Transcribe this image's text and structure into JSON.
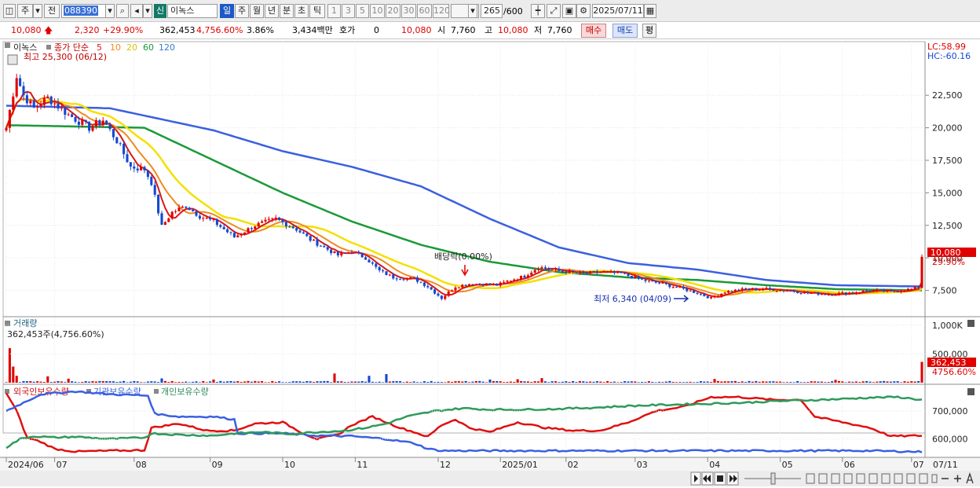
{
  "toolbar": {
    "market": "주",
    "prefix": "전",
    "code": "088390",
    "badge": "신",
    "stock_name": "이녹스",
    "periods": [
      "일",
      "주",
      "월",
      "년",
      "분",
      "초",
      "틱"
    ],
    "minutes": [
      "1",
      "3",
      "5",
      "10",
      "20",
      "30",
      "60",
      "120"
    ],
    "count": "265",
    "count_total": "/600",
    "date": "2025/07/11"
  },
  "quote": {
    "price": "10,080",
    "change": "2,320",
    "change_pct": "+29.90%",
    "volume": "362,453",
    "volume_pct": "4,756.60%",
    "turnover_pct": "3.86%",
    "amount": "3,434백만",
    "hoga_label": "호가",
    "hoga_value": "0",
    "hoga_price": "10,080",
    "open_label": "시",
    "open": "7,760",
    "high_label": "고",
    "high": "10,080",
    "low_label": "저",
    "low": "7,760",
    "buy": "매수",
    "sell": "매도",
    "avg": "평"
  },
  "colors": {
    "up": "#e00000",
    "down": "#1448d0",
    "ma5": "#d81818",
    "ma10": "#f08a20",
    "ma20": "#f4e000",
    "ma60": "#1a9a38",
    "ma120": "#3a60e0",
    "foreign": "#e01010",
    "institution": "#3a60e0",
    "individual": "#2e9a5a"
  },
  "chart_data": [
    {
      "type": "candlestick",
      "legend": {
        "name": "이녹스",
        "close_label": "종가 단순",
        "ma": [
          "5",
          "10",
          "20",
          "60",
          "120"
        ]
      },
      "high_note": "최고 25,300 (06/12)",
      "low_note": "최저 6,340 (04/09)",
      "event_note": "배당락(0.00%)",
      "lc": "LC:58.99",
      "hc": "HC:-60.16",
      "last_price_label": "10,080",
      "last_pct_label": "29.90%",
      "ylim": [
        5600,
        26500
      ],
      "yticks": [
        "22,500",
        "20,000",
        "17,500",
        "15,000",
        "12,500",
        "10,000",
        "7,500"
      ],
      "ytick_values": [
        22500,
        20000,
        17500,
        15000,
        12500,
        10000,
        7500
      ],
      "xticks": [
        "2024/06",
        "07",
        "08",
        "09",
        "10",
        "11",
        "12",
        "2025/01",
        "02",
        "03",
        "04",
        "05",
        "06",
        "07",
        "07/11"
      ],
      "xtick_days": [
        0,
        14,
        37,
        59,
        80,
        101,
        125,
        143,
        162,
        182,
        203,
        224,
        242,
        262,
        265
      ],
      "close_anchors": [
        [
          0,
          20000
        ],
        [
          3,
          24000
        ],
        [
          5,
          22500
        ],
        [
          8,
          21500
        ],
        [
          12,
          22300
        ],
        [
          18,
          21000
        ],
        [
          24,
          20000
        ],
        [
          28,
          20600
        ],
        [
          32,
          19000
        ],
        [
          36,
          17000
        ],
        [
          40,
          16800
        ],
        [
          42,
          15800
        ],
        [
          45,
          12400
        ],
        [
          48,
          13500
        ],
        [
          52,
          14000
        ],
        [
          56,
          13200
        ],
        [
          60,
          12800
        ],
        [
          66,
          11600
        ],
        [
          72,
          12500
        ],
        [
          78,
          13000
        ],
        [
          84,
          12200
        ],
        [
          88,
          11400
        ],
        [
          92,
          10800
        ],
        [
          96,
          10200
        ],
        [
          100,
          10500
        ],
        [
          104,
          10000
        ],
        [
          108,
          9000
        ],
        [
          112,
          8500
        ],
        [
          118,
          8400
        ],
        [
          122,
          7800
        ],
        [
          126,
          6900
        ],
        [
          130,
          7800
        ],
        [
          134,
          8000
        ],
        [
          138,
          8000
        ],
        [
          142,
          7900
        ],
        [
          146,
          8300
        ],
        [
          150,
          8600
        ],
        [
          154,
          9300
        ],
        [
          160,
          9000
        ],
        [
          166,
          8800
        ],
        [
          172,
          8900
        ],
        [
          178,
          8800
        ],
        [
          184,
          8300
        ],
        [
          190,
          8000
        ],
        [
          196,
          7600
        ],
        [
          200,
          7300
        ],
        [
          204,
          6900
        ],
        [
          208,
          7400
        ],
        [
          214,
          7600
        ],
        [
          220,
          7600
        ],
        [
          226,
          7500
        ],
        [
          232,
          7300
        ],
        [
          238,
          7200
        ],
        [
          244,
          7300
        ],
        [
          250,
          7500
        ],
        [
          256,
          7400
        ],
        [
          262,
          7600
        ],
        [
          264,
          7760
        ],
        [
          265,
          10080
        ]
      ],
      "ma60_anchors": [
        [
          0,
          20200
        ],
        [
          40,
          20000
        ],
        [
          60,
          17500
        ],
        [
          80,
          15000
        ],
        [
          100,
          12800
        ],
        [
          120,
          11000
        ],
        [
          140,
          9700
        ],
        [
          160,
          8900
        ],
        [
          180,
          8500
        ],
        [
          200,
          8300
        ],
        [
          220,
          7900
        ],
        [
          240,
          7600
        ],
        [
          265,
          7500
        ]
      ],
      "ma120_anchors": [
        [
          0,
          21700
        ],
        [
          30,
          21500
        ],
        [
          60,
          19800
        ],
        [
          80,
          18200
        ],
        [
          100,
          17000
        ],
        [
          120,
          15500
        ],
        [
          140,
          13000
        ],
        [
          160,
          10800
        ],
        [
          180,
          9600
        ],
        [
          200,
          9100
        ],
        [
          220,
          8300
        ],
        [
          240,
          7900
        ],
        [
          265,
          7800
        ]
      ]
    },
    {
      "type": "bar",
      "title": "거래량",
      "label": "362,453주(4,756.60%)",
      "ylim": [
        0,
        1120000
      ],
      "yticks": [
        "1,000K",
        "500,000"
      ],
      "ytick_values": [
        1000000,
        500000
      ],
      "last_label": "362,453",
      "last_pct": "4756.60%",
      "spikes": [
        [
          1,
          600000
        ],
        [
          2,
          280000
        ],
        [
          3,
          120000
        ],
        [
          12,
          110000
        ],
        [
          18,
          70000
        ],
        [
          45,
          75000
        ],
        [
          60,
          55000
        ],
        [
          95,
          160000
        ],
        [
          105,
          120000
        ],
        [
          110,
          150000
        ],
        [
          140,
          55000
        ],
        [
          148,
          60000
        ],
        [
          155,
          80000
        ],
        [
          205,
          65000
        ],
        [
          240,
          50000
        ],
        [
          265,
          362453
        ]
      ]
    },
    {
      "type": "line",
      "series": [
        {
          "name": "외국인보유수량",
          "anchors": [
            [
              0,
              765000
            ],
            [
              3,
              700000
            ],
            [
              6,
              605000
            ],
            [
              10,
              590000
            ],
            [
              14,
              565000
            ],
            [
              20,
              555000
            ],
            [
              30,
              558000
            ],
            [
              40,
              560000
            ],
            [
              42,
              640000
            ],
            [
              50,
              655000
            ],
            [
              58,
              630000
            ],
            [
              66,
              630000
            ],
            [
              72,
              655000
            ],
            [
              80,
              660000
            ],
            [
              86,
              620000
            ],
            [
              90,
              600000
            ],
            [
              96,
              615000
            ],
            [
              100,
              650000
            ],
            [
              106,
              680000
            ],
            [
              110,
              660000
            ],
            [
              114,
              640000
            ],
            [
              118,
              625000
            ],
            [
              122,
              608000
            ],
            [
              126,
              650000
            ],
            [
              130,
              670000
            ],
            [
              134,
              640000
            ],
            [
              140,
              625000
            ],
            [
              148,
              660000
            ],
            [
              156,
              640000
            ],
            [
              164,
              630000
            ],
            [
              172,
              630000
            ],
            [
              180,
              660000
            ],
            [
              188,
              700000
            ],
            [
              196,
              715000
            ],
            [
              204,
              750000
            ],
            [
              212,
              750000
            ],
            [
              222,
              740000
            ],
            [
              230,
              740000
            ],
            [
              234,
              680000
            ],
            [
              242,
              660000
            ],
            [
              250,
              640000
            ],
            [
              256,
              610000
            ],
            [
              265,
              612000
            ]
          ]
        },
        {
          "name": "기관보유수량",
          "anchors": [
            [
              0,
              700000
            ],
            [
              10,
              760000
            ],
            [
              20,
              770000
            ],
            [
              30,
              760000
            ],
            [
              41,
              755000
            ],
            [
              43,
              690000
            ],
            [
              50,
              680000
            ],
            [
              60,
              680000
            ],
            [
              66,
              670000
            ],
            [
              67,
              620000
            ],
            [
              80,
              620000
            ],
            [
              90,
              612000
            ],
            [
              100,
              610000
            ],
            [
              110,
              600000
            ],
            [
              118,
              585000
            ],
            [
              122,
              565000
            ],
            [
              126,
              558000
            ],
            [
              140,
              558000
            ],
            [
              160,
              558000
            ],
            [
              190,
              558000
            ],
            [
              230,
              558000
            ],
            [
              250,
              558000
            ],
            [
              265,
              554000
            ]
          ]
        },
        {
          "name": "개인보유수량",
          "anchors": [
            [
              0,
              570000
            ],
            [
              4,
              600000
            ],
            [
              8,
              610000
            ],
            [
              14,
              605000
            ],
            [
              20,
              608000
            ],
            [
              30,
              600000
            ],
            [
              40,
              605000
            ],
            [
              42,
              620000
            ],
            [
              50,
              615000
            ],
            [
              60,
              612000
            ],
            [
              66,
              620000
            ],
            [
              74,
              625000
            ],
            [
              82,
              618000
            ],
            [
              90,
              625000
            ],
            [
              98,
              630000
            ],
            [
              104,
              640000
            ],
            [
              110,
              655000
            ],
            [
              116,
              680000
            ],
            [
              124,
              700000
            ],
            [
              132,
              710000
            ],
            [
              140,
              705000
            ],
            [
              150,
              705000
            ],
            [
              160,
              708000
            ],
            [
              170,
              712000
            ],
            [
              180,
              718000
            ],
            [
              190,
              722000
            ],
            [
              200,
              725000
            ],
            [
              214,
              730000
            ],
            [
              222,
              735000
            ],
            [
              230,
              738000
            ],
            [
              240,
              742000
            ],
            [
              250,
              748000
            ],
            [
              258,
              750000
            ],
            [
              265,
              740000
            ]
          ]
        }
      ],
      "ylim": [
        540000,
        790000
      ],
      "yticks": [
        "700,000",
        "600,000"
      ],
      "ytick_values": [
        700000,
        600000
      ]
    }
  ]
}
